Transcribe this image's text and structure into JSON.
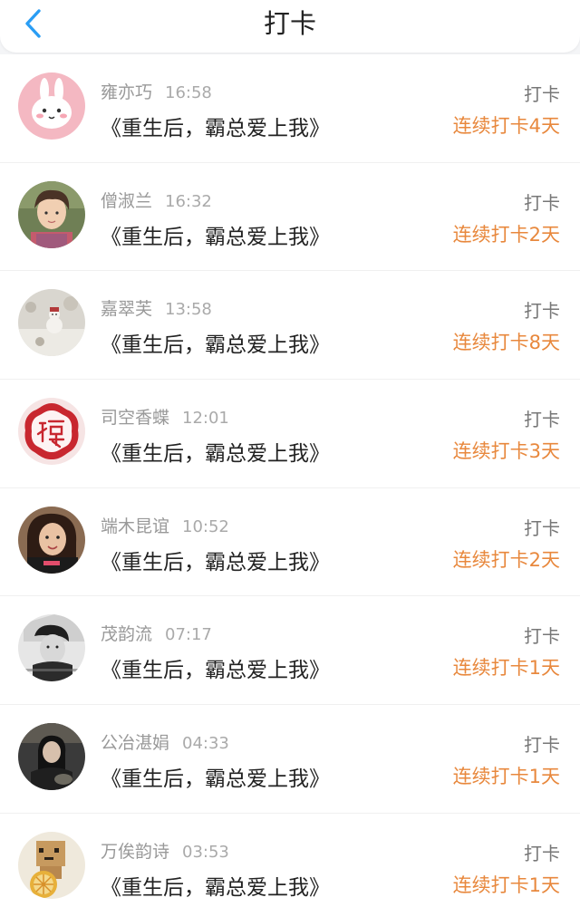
{
  "header": {
    "title": "打卡",
    "back_icon": "chevron-left-icon",
    "accent_color": "#2a9df4"
  },
  "colors": {
    "streak": "#e8883d",
    "name": "#999999"
  },
  "entries": [
    {
      "name": "雍亦巧",
      "time": "16:58",
      "book": "《重生后，霸总爱上我》",
      "action": "打卡",
      "streak": "连续打卡4天",
      "avatar": "bunny-avatar"
    },
    {
      "name": "僧淑兰",
      "time": "16:32",
      "book": "《重生后，霸总爱上我》",
      "action": "打卡",
      "streak": "连续打卡2天",
      "avatar": "boy-avatar"
    },
    {
      "name": "嘉翠芙",
      "time": "13:58",
      "book": "《重生后，霸总爱上我》",
      "action": "打卡",
      "streak": "连续打卡8天",
      "avatar": "snow-avatar"
    },
    {
      "name": "司空香蝶",
      "time": "12:01",
      "book": "《重生后，霸总爱上我》",
      "action": "打卡",
      "streak": "连续打卡3天",
      "avatar": "fu-avatar"
    },
    {
      "name": "端木昆谊",
      "time": "10:52",
      "book": "《重生后，霸总爱上我》",
      "action": "打卡",
      "streak": "连续打卡2天",
      "avatar": "girl-avatar"
    },
    {
      "name": "茂韵流",
      "time": "07:17",
      "book": "《重生后，霸总爱上我》",
      "action": "打卡",
      "streak": "连续打卡1天",
      "avatar": "bw-avatar"
    },
    {
      "name": "公冶湛娟",
      "time": "04:33",
      "book": "《重生后，霸总爱上我》",
      "action": "打卡",
      "streak": "连续打卡1天",
      "avatar": "dark-girl-avatar"
    },
    {
      "name": "万俟韵诗",
      "time": "03:53",
      "book": "《重生后，霸总爱上我》",
      "action": "打卡",
      "streak": "连续打卡1天",
      "avatar": "box-figure-avatar"
    }
  ]
}
